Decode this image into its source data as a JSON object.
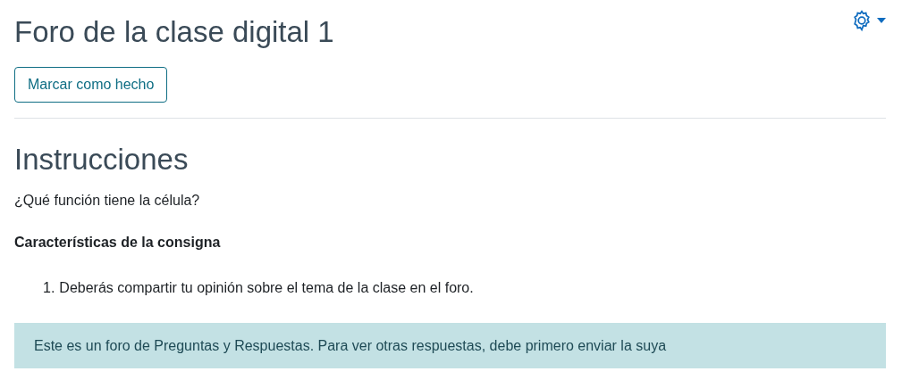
{
  "page": {
    "title": "Foro de la clase digital 1"
  },
  "mark_done_button": {
    "label": "Marcar como hecho"
  },
  "section": {
    "heading": "Instrucciones",
    "question": "¿Qué función tiene la célula?",
    "subheading": "Características de la consigna",
    "list": [
      {
        "marker": "1.",
        "text": "Deberás compartir tu opinión sobre el tema de la clase en el foro."
      }
    ]
  },
  "notice": {
    "text": "Este es un foro de Preguntas y Respuestas. Para ver otras respuestas, debe primero enviar la suya"
  }
}
